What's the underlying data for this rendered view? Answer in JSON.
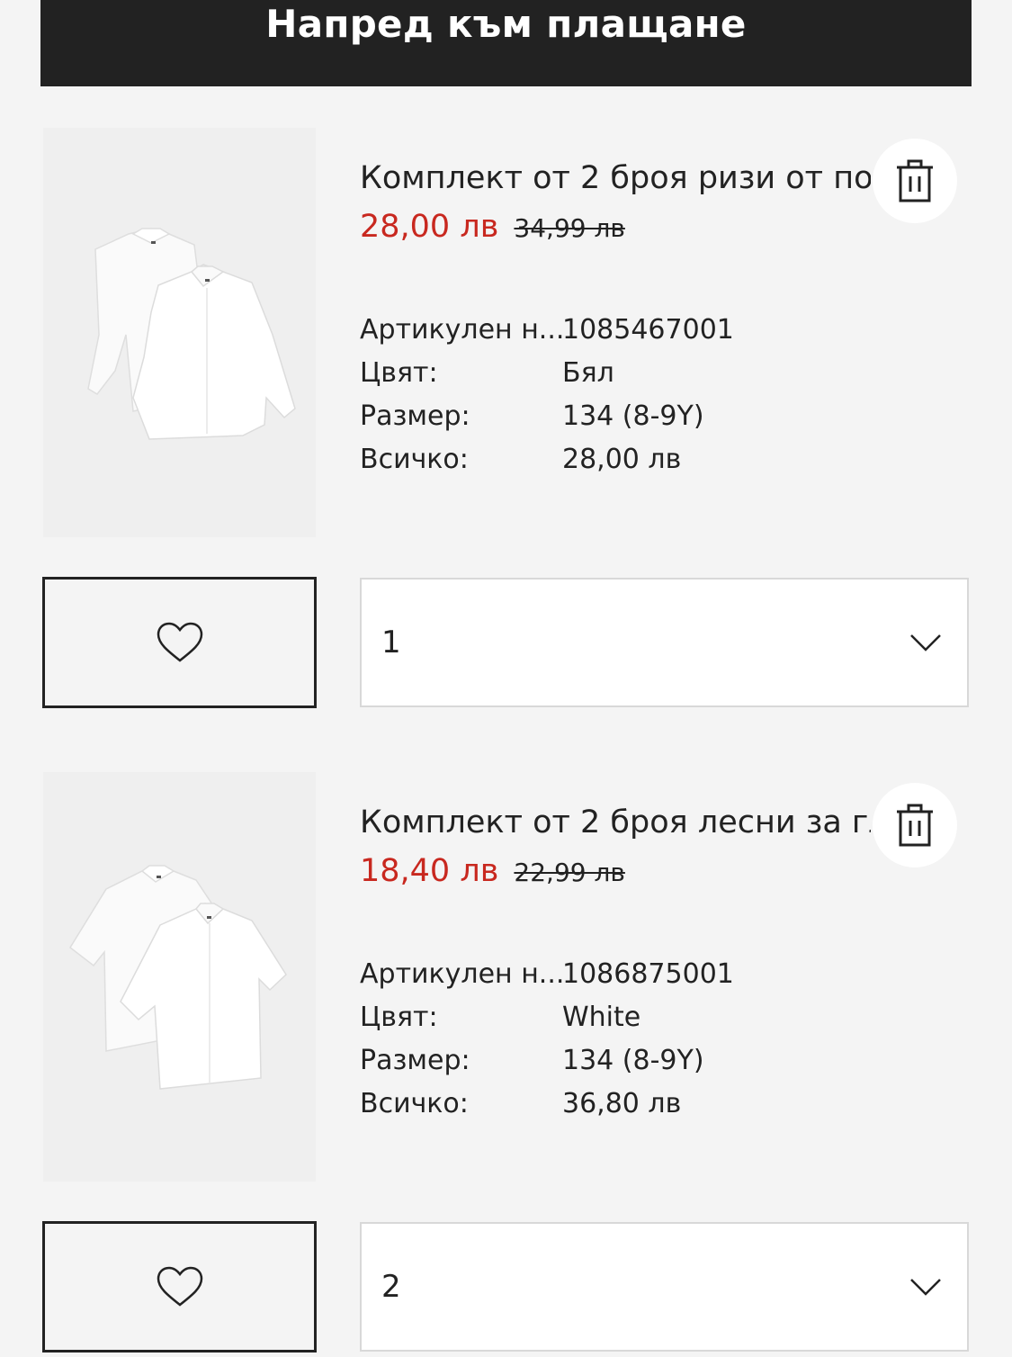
{
  "checkout": {
    "label": "Напред към плащане"
  },
  "cart": {
    "items": [
      {
        "title": "Комплект от 2 броя ризи от поплин",
        "price_sale": "28,00 лв",
        "price_original": "34,99 лв",
        "article_label": "Артикулен н...",
        "article_value": "1085467001",
        "color_label": "Цвят:",
        "color_value": "Бял",
        "size_label": "Размер:",
        "size_value": "134 (8-9Y)",
        "total_label": "Всичко:",
        "total_value": "28,00 лв",
        "quantity": "1",
        "image_icon": "long-sleeve-shirts-image"
      },
      {
        "title": "Комплект от 2 броя лесни за гладене ризи",
        "price_sale": "18,40 лв",
        "price_original": "22,99 лв",
        "article_label": "Артикулен н...",
        "article_value": "1086875001",
        "color_label": "Цвят:",
        "color_value": "White",
        "size_label": "Размер:",
        "size_value": "134 (8-9Y)",
        "total_label": "Всичко:",
        "total_value": "36,80 лв",
        "quantity": "2",
        "image_icon": "short-sleeve-shirts-image"
      }
    ]
  },
  "colors": {
    "sale": "#c8281f",
    "button_bg": "#222222",
    "page_bg": "#f4f4f4"
  },
  "icons": {
    "delete": "trash-icon",
    "favourite": "heart-icon",
    "dropdown": "chevron-down-icon"
  }
}
